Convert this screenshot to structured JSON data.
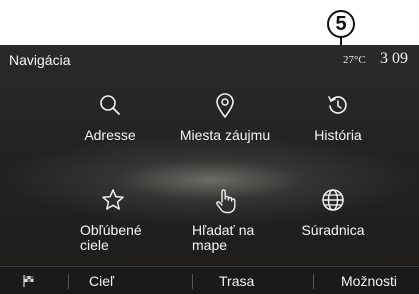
{
  "callout": {
    "number": "5"
  },
  "status": {
    "title": "Navigácia",
    "temperature": "27°C",
    "time": "3 09"
  },
  "menu": [
    {
      "id": "adresse",
      "label": "Adresse",
      "icon": "search-icon"
    },
    {
      "id": "poi",
      "label": "Miesta záujmu",
      "icon": "map-pin-icon"
    },
    {
      "id": "historia",
      "label": "História",
      "icon": "history-icon"
    },
    {
      "id": "oblubene",
      "label": "Obľúbené ciele",
      "icon": "star-icon"
    },
    {
      "id": "hladat",
      "label": "Hľadať na mape",
      "icon": "hand-pointer-icon"
    },
    {
      "id": "suradnica",
      "label": "Súradnica",
      "icon": "globe-icon"
    }
  ],
  "bottom_bar": {
    "flag_icon": "flag-icon",
    "items": [
      "Cieľ",
      "Trasa",
      "Možnosti"
    ]
  }
}
